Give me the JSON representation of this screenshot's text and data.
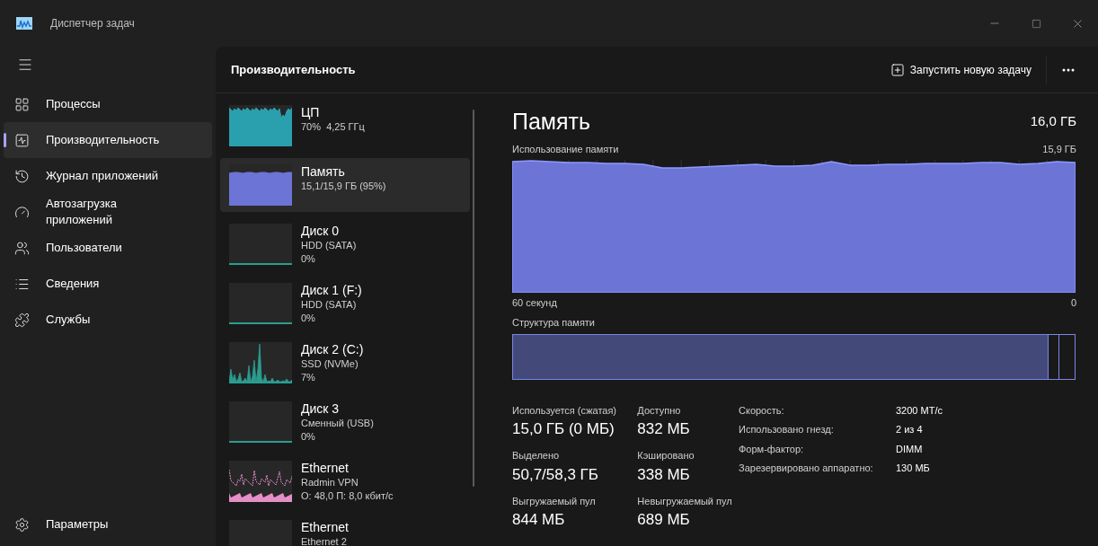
{
  "window": {
    "title": "Диспетчер задач"
  },
  "sidebar": {
    "items": [
      {
        "label": "Процессы",
        "selected": false
      },
      {
        "label": "Производительность",
        "selected": true
      },
      {
        "label": "Журнал приложений",
        "selected": false
      },
      {
        "label": "Автозагрузка приложений",
        "selected": false
      },
      {
        "label": "Пользователи",
        "selected": false
      },
      {
        "label": "Сведения",
        "selected": false
      },
      {
        "label": "Службы",
        "selected": false
      }
    ],
    "settings": "Параметры"
  },
  "header": {
    "title": "Производительность",
    "run_task": "Запустить новую задачу"
  },
  "devices": [
    {
      "name": "ЦП",
      "lines": [
        "70%  4,25 ГГц"
      ],
      "kind": "cpu",
      "color": "#2a9fad",
      "selected": false
    },
    {
      "name": "Память",
      "lines": [
        "15,1/15,9 ГБ (95%)"
      ],
      "kind": "memory",
      "color": "#6c74d6",
      "selected": true
    },
    {
      "name": "Диск 0",
      "lines": [
        "HDD (SATA)",
        "0%"
      ],
      "kind": "flat",
      "color": "#2a9d8f",
      "selected": false
    },
    {
      "name": "Диск 1 (F:)",
      "lines": [
        "HDD (SATA)",
        "0%"
      ],
      "kind": "flat",
      "color": "#2a9d8f",
      "selected": false
    },
    {
      "name": "Диск 2 (C:)",
      "lines": [
        "SSD (NVMe)",
        "7%"
      ],
      "kind": "spiky",
      "color": "#2a9d8f",
      "selected": false
    },
    {
      "name": "Диск 3",
      "lines": [
        "Сменный (USB)",
        "0%"
      ],
      "kind": "flat",
      "color": "#2a9d8f",
      "selected": false
    },
    {
      "name": "Ethernet",
      "lines": [
        "Radmin VPN",
        "О: 48,0 П: 8,0 кбит/с"
      ],
      "kind": "network",
      "color": "#e58fc8",
      "selected": false
    },
    {
      "name": "Ethernet",
      "lines": [
        "Ethernet 2"
      ],
      "kind": "empty",
      "selected": false
    }
  ],
  "detail": {
    "title": "Память",
    "total": "16,0 ГБ",
    "usage_graph": {
      "title": "Использование памяти",
      "max_label": "15,9 ГБ",
      "start_label": "60 секунд",
      "end_label": "0"
    },
    "composition": {
      "title": "Структура памяти",
      "level": 0.953
    },
    "stats": [
      {
        "label": "Используется (сжатая)",
        "value": "15,0 ГБ (0 МБ)"
      },
      {
        "label": "Доступно",
        "value": "832 МБ"
      },
      {
        "label": "Выделено",
        "value": "50,7/58,3 ГБ"
      },
      {
        "label": "Кэшировано",
        "value": "338 МБ"
      },
      {
        "label": "Выгружаемый пул",
        "value": "844 МБ"
      },
      {
        "label": "Невыгружаемый пул",
        "value": "689 МБ"
      }
    ],
    "properties": [
      {
        "label": "Скорость:",
        "value": "3200 МТ/с"
      },
      {
        "label": "Использовано гнезд:",
        "value": "2 из 4"
      },
      {
        "label": "Форм-фактор:",
        "value": "DIMM"
      },
      {
        "label": "Зарезервировано аппаратно:",
        "value": "130 МБ"
      }
    ]
  }
}
